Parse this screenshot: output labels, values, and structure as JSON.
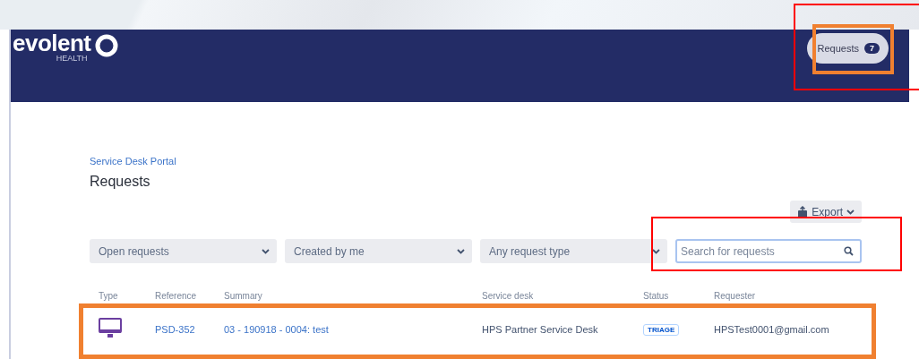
{
  "header": {
    "logo": {
      "word": "evolent",
      "sub": "HEALTH"
    },
    "requests_button": {
      "label": "Requests",
      "count": "7"
    }
  },
  "breadcrumb": "Service Desk Portal",
  "title": "Requests",
  "export_button": {
    "label": "Export"
  },
  "filters": [
    {
      "value": "Open requests"
    },
    {
      "value": "Created by me"
    },
    {
      "value": "Any request type"
    }
  ],
  "search": {
    "placeholder": "Search for requests"
  },
  "table": {
    "columns": [
      "Type",
      "Reference",
      "Summary",
      "Service desk",
      "Status",
      "Requester"
    ],
    "rows": [
      {
        "kind": "computer",
        "reference": "PSD-352",
        "summary": "03 - 190918 - 0004: test",
        "service_desk": "HPS Partner Service Desk",
        "status": "TRIAGE",
        "requester": "HPSTest0001@gmail.com"
      }
    ]
  },
  "annotations": [
    {
      "color": "#ff0000"
    },
    {
      "color": "#f08030"
    },
    {
      "color": "#ff0000"
    },
    {
      "color": "#f08030"
    }
  ]
}
